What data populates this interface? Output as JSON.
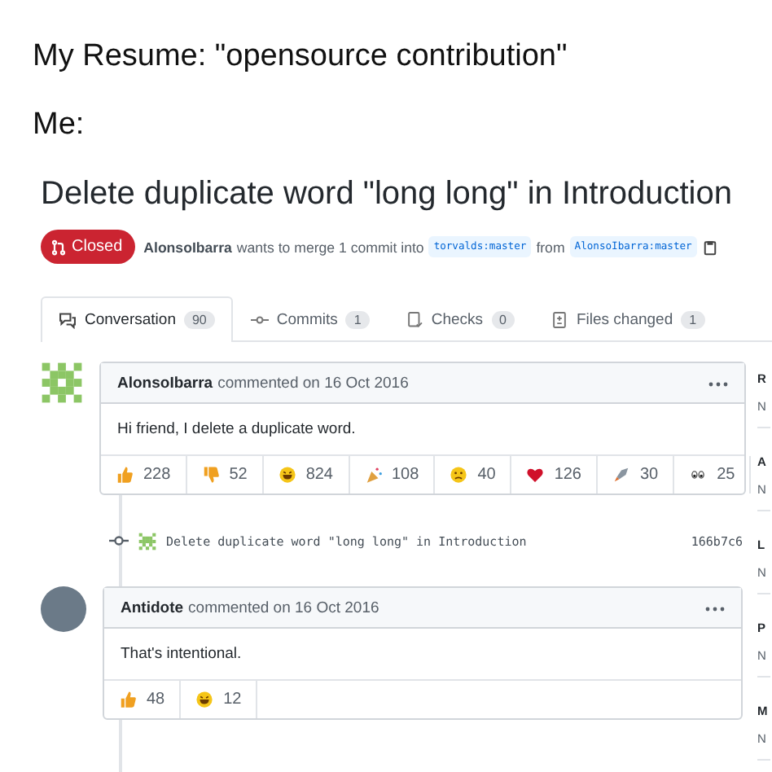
{
  "meme": {
    "caption": "My Resume: \"opensource contribution\"",
    "label": "Me:"
  },
  "pull_request": {
    "title": "Delete duplicate word \"long long\" in Introduction",
    "state": {
      "label": "Closed",
      "kind": "closed"
    },
    "author": "AlonsoIbarra",
    "summary": "wants to merge 1 commit into",
    "base_branch": "torvalds:master",
    "from_word": "from",
    "head_branch": "AlonsoIbarra:master"
  },
  "tabs": [
    {
      "label": "Conversation",
      "count": "90",
      "selected": true,
      "kind": "conversation"
    },
    {
      "label": "Commits",
      "count": "1",
      "selected": false,
      "kind": "commits"
    },
    {
      "label": "Checks",
      "count": "0",
      "selected": false,
      "kind": "checks"
    },
    {
      "label": "Files changed",
      "count": "1",
      "selected": false,
      "kind": "files"
    }
  ],
  "timeline": [
    {
      "kind": "comment",
      "avatar": {
        "kind": "identicon"
      },
      "author": "AlonsoIbarra",
      "action": "commented on 16 Oct 2016",
      "body": "Hi friend, I delete a duplicate word.",
      "reactions": [
        {
          "kind": "thumbs_up",
          "count": "228"
        },
        {
          "kind": "thumbs_down",
          "count": "52"
        },
        {
          "kind": "laugh",
          "count": "824"
        },
        {
          "kind": "hooray",
          "count": "108"
        },
        {
          "kind": "confused",
          "count": "40"
        },
        {
          "kind": "heart",
          "count": "126"
        },
        {
          "kind": "rocket",
          "count": "30"
        },
        {
          "kind": "eyes",
          "count": "25"
        }
      ]
    },
    {
      "kind": "commit",
      "message": "Delete duplicate word \"long long\" in Introduction",
      "sha": "166b7c6"
    },
    {
      "kind": "comment",
      "avatar": {
        "kind": "photo"
      },
      "author": "Antidote",
      "action": "commented on 16 Oct 2016",
      "body": "That's intentional.",
      "reactions": [
        {
          "kind": "thumbs_up",
          "count": "48"
        },
        {
          "kind": "laugh",
          "count": "12"
        }
      ]
    }
  ],
  "sidebar": [
    {
      "heading": "R",
      "value": "N"
    },
    {
      "heading": "A",
      "value": "N"
    },
    {
      "heading": "L",
      "value": "N"
    },
    {
      "heading": "P",
      "value": "N"
    },
    {
      "heading": "M",
      "value": "N"
    }
  ]
}
